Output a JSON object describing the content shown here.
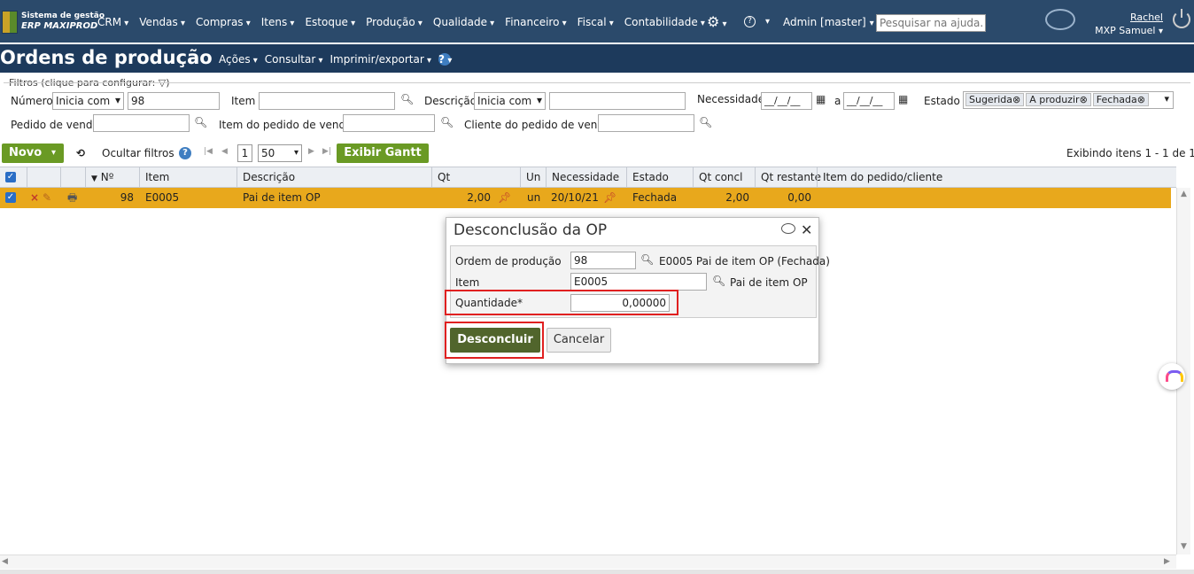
{
  "header": {
    "brand_line1": "Sistema de gestão",
    "brand_line2": "ERP MAXIPROD",
    "menu": [
      "CRM",
      "Vendas",
      "Compras",
      "Itens",
      "Estoque",
      "Produção",
      "Qualidade",
      "Financeiro",
      "Fiscal",
      "Contabilidade"
    ],
    "admin": "Admin [master]",
    "search_placeholder": "Pesquisar na ajuda...",
    "user_name": "Rachel",
    "company": "MXP Samuel"
  },
  "page": {
    "title": "Ordens de produção",
    "menu": [
      "Ações",
      "Consultar",
      "Imprimir/exportar"
    ]
  },
  "filters": {
    "legend": "Filtros (clique para configurar:",
    "numero_label": "Número",
    "numero_op": "Inicia com",
    "numero_value": "98",
    "item_label": "Item",
    "descricao_label": "Descrição",
    "descricao_op": "Inicia com",
    "necessidade_label": "Necessidade",
    "date_placeholder": "__/__/__",
    "a_label": "a",
    "estado_label": "Estado",
    "estado_tags": [
      "Sugerida",
      "A produzir",
      "Fechada"
    ],
    "pedido_label": "Pedido de venda",
    "item_pedido_label": "Item do pedido de venda",
    "cliente_label": "Cliente do pedido de venda"
  },
  "toolbar": {
    "novo": "Novo",
    "ocultar": "Ocultar filtros",
    "page": "1",
    "per_page": "50",
    "gantt": "Exibir Gantt",
    "showing": "Exibindo itens 1 - 1 de 1"
  },
  "grid": {
    "headers": [
      "Nº",
      "Item",
      "Descrição",
      "Qt",
      "Un",
      "Necessidade",
      "Estado",
      "Qt concl",
      "Qt restante",
      "Item do pedido/cliente"
    ],
    "row": {
      "numero": "98",
      "item": "E0005",
      "descricao": "Pai de item OP",
      "qt": "2,00",
      "un": "un",
      "necessidade": "20/10/21",
      "estado": "Fechada",
      "qt_concl": "2,00",
      "qt_restante": "0,00"
    }
  },
  "dialog": {
    "title": "Desconclusão da OP",
    "op_label": "Ordem de produção",
    "op_value": "98",
    "op_desc": "E0005 Pai de item OP (Fechada)",
    "item_label": "Item",
    "item_value": "E0005",
    "item_desc": "Pai de item OP",
    "qty_label": "Quantidade*",
    "qty_value": "0,00000",
    "confirm": "Desconcluir",
    "cancel": "Cancelar"
  },
  "colors": {
    "header_bg": "#2b4a6b",
    "title_bg": "#1d3a5c",
    "row_selected": "#e8a81c",
    "green_button": "#6a9a24",
    "dialog_button": "#51652c",
    "highlight": "#e02020"
  }
}
